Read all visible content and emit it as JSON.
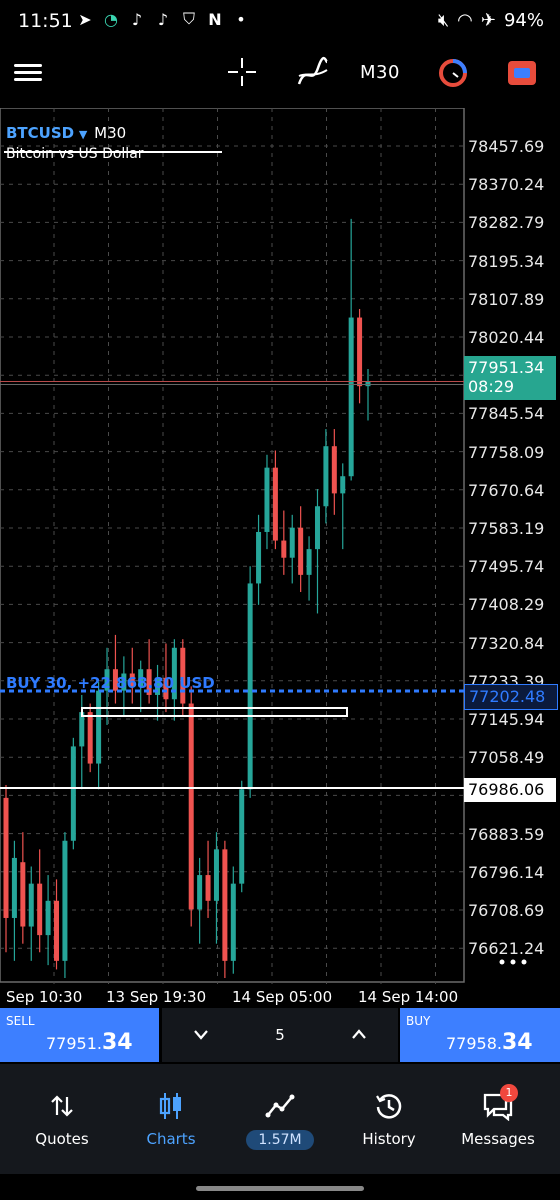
{
  "status_bar": {
    "time": "11:51",
    "battery": "94%",
    "left_icons": [
      "telegram-icon",
      "n-logo-icon",
      "tiktok-icon",
      "tiktok-icon",
      "shield-icon",
      "n-icon",
      "dot-icon"
    ],
    "right_icons": [
      "mute-icon",
      "wifi-icon",
      "airplane-icon"
    ]
  },
  "toolbar": {
    "timeframe": "M30"
  },
  "chart": {
    "symbol": "BTCUSD",
    "symbol_timeframe": "M30",
    "description": "Bitcoin vs US Dollar",
    "buy_line_label": "BUY 30, +22 868.80 USD",
    "current_price": "77951.34",
    "countdown": "08:29",
    "buy_price_tag": "77202.48",
    "level_price_tag": "76986.06",
    "price_ticks": [
      "78457.69",
      "78370.24",
      "78282.79",
      "78195.34",
      "78107.89",
      "78020.44",
      "77845.54",
      "77758.09",
      "77670.64",
      "77583.19",
      "77495.74",
      "77408.29",
      "77320.84",
      "77233.39",
      "77145.94",
      "77058.49",
      "76883.59",
      "76796.14",
      "76708.69",
      "76621.24"
    ],
    "time_ticks": [
      "Sep 10:30",
      "13 Sep 19:30",
      "14 Sep 05:00",
      "14 Sep 14:00"
    ],
    "colors": {
      "bull": "#26a69a",
      "bear": "#ef5350",
      "grid": "#4a4a4a",
      "buy_line": "#2f7bff"
    }
  },
  "chart_data": {
    "type": "candlestick",
    "symbol": "BTCUSD",
    "timeframe": "M30",
    "ylim": [
      76560,
      78500
    ],
    "candles": [
      {
        "o": 76980,
        "h": 77010,
        "l": 76620,
        "c": 76700
      },
      {
        "o": 76700,
        "h": 76880,
        "l": 76600,
        "c": 76840
      },
      {
        "o": 76830,
        "h": 76900,
        "l": 76640,
        "c": 76680
      },
      {
        "o": 76680,
        "h": 76820,
        "l": 76600,
        "c": 76780
      },
      {
        "o": 76780,
        "h": 76860,
        "l": 76620,
        "c": 76660
      },
      {
        "o": 76660,
        "h": 76800,
        "l": 76590,
        "c": 76740
      },
      {
        "o": 76740,
        "h": 76790,
        "l": 76580,
        "c": 76600
      },
      {
        "o": 76600,
        "h": 76900,
        "l": 76560,
        "c": 76880
      },
      {
        "o": 76880,
        "h": 77120,
        "l": 76860,
        "c": 77100
      },
      {
        "o": 77100,
        "h": 77220,
        "l": 77000,
        "c": 77180
      },
      {
        "o": 77180,
        "h": 77200,
        "l": 77040,
        "c": 77060
      },
      {
        "o": 77060,
        "h": 77250,
        "l": 77000,
        "c": 77230
      },
      {
        "o": 77230,
        "h": 77330,
        "l": 77150,
        "c": 77280
      },
      {
        "o": 77280,
        "h": 77360,
        "l": 77200,
        "c": 77230
      },
      {
        "o": 77230,
        "h": 77310,
        "l": 77170,
        "c": 77270
      },
      {
        "o": 77270,
        "h": 77330,
        "l": 77200,
        "c": 77240
      },
      {
        "o": 77240,
        "h": 77300,
        "l": 77180,
        "c": 77280
      },
      {
        "o": 77280,
        "h": 77350,
        "l": 77200,
        "c": 77220
      },
      {
        "o": 77220,
        "h": 77290,
        "l": 77160,
        "c": 77260
      },
      {
        "o": 77260,
        "h": 77340,
        "l": 77180,
        "c": 77210
      },
      {
        "o": 77210,
        "h": 77350,
        "l": 77160,
        "c": 77330
      },
      {
        "o": 77330,
        "h": 77350,
        "l": 77170,
        "c": 77200
      },
      {
        "o": 77200,
        "h": 77240,
        "l": 76680,
        "c": 76720
      },
      {
        "o": 76720,
        "h": 76840,
        "l": 76640,
        "c": 76800
      },
      {
        "o": 76800,
        "h": 76880,
        "l": 76700,
        "c": 76740
      },
      {
        "o": 76740,
        "h": 76900,
        "l": 76640,
        "c": 76860
      },
      {
        "o": 76860,
        "h": 76880,
        "l": 76560,
        "c": 76600
      },
      {
        "o": 76600,
        "h": 76820,
        "l": 76570,
        "c": 76780
      },
      {
        "o": 76780,
        "h": 77020,
        "l": 76760,
        "c": 77000
      },
      {
        "o": 77000,
        "h": 77520,
        "l": 76980,
        "c": 77480
      },
      {
        "o": 77480,
        "h": 77640,
        "l": 77430,
        "c": 77600
      },
      {
        "o": 77600,
        "h": 77780,
        "l": 77560,
        "c": 77750
      },
      {
        "o": 77750,
        "h": 77790,
        "l": 77560,
        "c": 77580
      },
      {
        "o": 77580,
        "h": 77650,
        "l": 77500,
        "c": 77540
      },
      {
        "o": 77540,
        "h": 77640,
        "l": 77480,
        "c": 77610
      },
      {
        "o": 77610,
        "h": 77660,
        "l": 77460,
        "c": 77500
      },
      {
        "o": 77500,
        "h": 77590,
        "l": 77440,
        "c": 77560
      },
      {
        "o": 77560,
        "h": 77700,
        "l": 77410,
        "c": 77660
      },
      {
        "o": 77660,
        "h": 77840,
        "l": 77620,
        "c": 77800
      },
      {
        "o": 77800,
        "h": 77840,
        "l": 77640,
        "c": 77690
      },
      {
        "o": 77690,
        "h": 77760,
        "l": 77560,
        "c": 77730
      },
      {
        "o": 77730,
        "h": 78330,
        "l": 77720,
        "c": 78100
      },
      {
        "o": 78100,
        "h": 78120,
        "l": 77900,
        "c": 77940
      },
      {
        "o": 77940,
        "h": 77980,
        "l": 77860,
        "c": 77951
      }
    ]
  },
  "trade_bar": {
    "sell_label": "SELL",
    "sell_price_main": "77951.",
    "sell_price_big": "34",
    "buy_label": "BUY",
    "buy_price_main": "77958.",
    "buy_price_big": "34",
    "lot": "5"
  },
  "bottom_nav": {
    "items": [
      {
        "label": "Quotes"
      },
      {
        "label": "Charts"
      },
      {
        "label": "1.57M"
      },
      {
        "label": "History"
      },
      {
        "label": "Messages"
      }
    ],
    "messages_badge": "1"
  }
}
